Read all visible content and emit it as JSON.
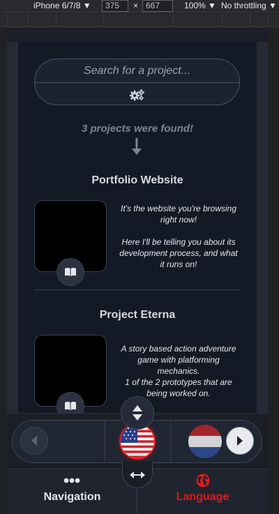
{
  "devtools": {
    "device": "iPhone 6/7/8 ▼",
    "width": "375",
    "x": "×",
    "height": "667",
    "zoom": "100% ▼",
    "throttle": "No throttling ▼"
  },
  "search": {
    "placeholder": "Search for a project...",
    "filter_icon": "gears-icon"
  },
  "results": {
    "found_text": "3 projects were found!"
  },
  "projects": [
    {
      "title": "Portfolio Website",
      "desc": [
        "It's the website you're browsing",
        "right now!",
        "",
        "Here I'll be telling you about its",
        "development process, and what",
        "it runs on!"
      ]
    },
    {
      "title": "Project Eterna",
      "desc": [
        "A story based action adventure",
        "game with platforming",
        "mechanics.",
        "1 of the 2 prototypes that are",
        "being worked on."
      ]
    }
  ],
  "language_picker": {
    "selected": "United States",
    "next": "Netherlands"
  },
  "nav": {
    "navigation_label": "Navigation",
    "language_label": "Language"
  },
  "colors": {
    "accent_red": "#e01b1b",
    "panel": "#141a25",
    "text": "#d6d9df"
  }
}
